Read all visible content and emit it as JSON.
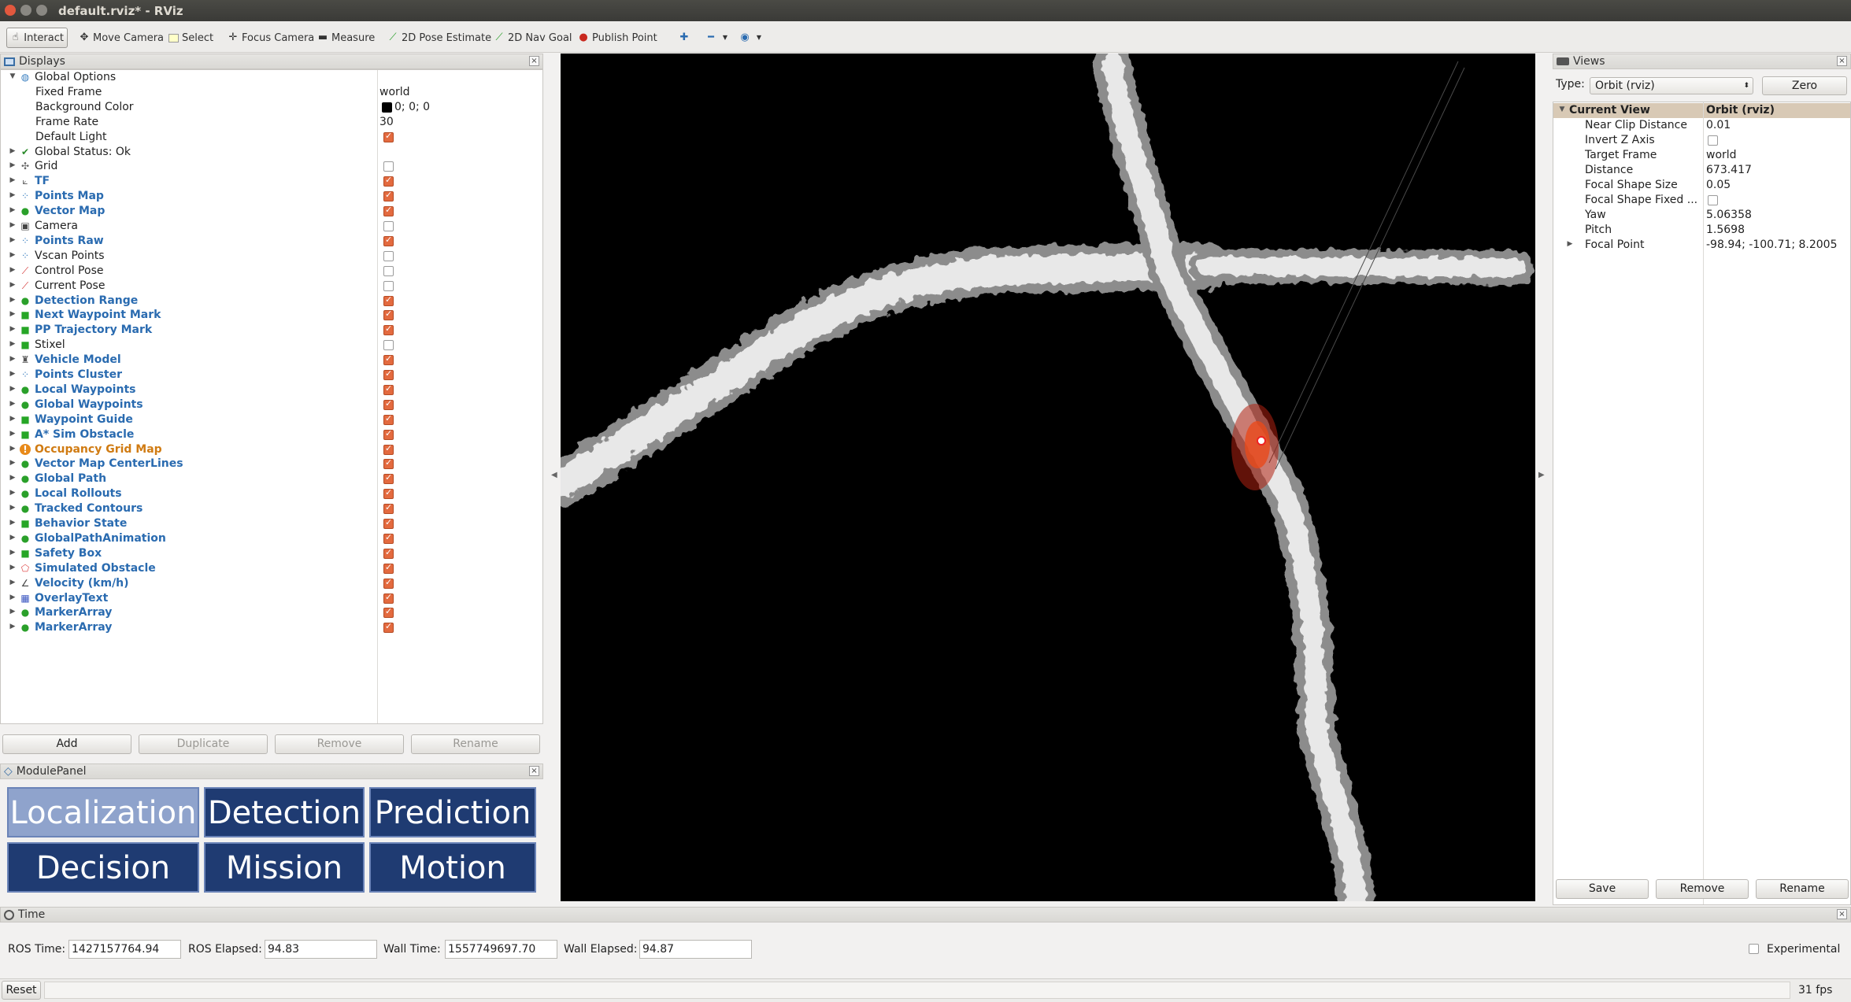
{
  "window": {
    "title": "default.rviz* - RViz"
  },
  "toolbar": {
    "tools": [
      {
        "label": "Interact",
        "icon": "hand-icon"
      },
      {
        "label": "Move Camera",
        "icon": "move-icon"
      },
      {
        "label": "Select",
        "icon": "select-icon"
      },
      {
        "label": "Focus Camera",
        "icon": "focus-icon"
      },
      {
        "label": "Measure",
        "icon": "ruler-icon"
      },
      {
        "label": "2D Pose Estimate",
        "icon": "pose-arrow-icon"
      },
      {
        "label": "2D Nav Goal",
        "icon": "nav-arrow-icon"
      },
      {
        "label": "Publish Point",
        "icon": "pin-icon"
      }
    ]
  },
  "displays": {
    "title": "Displays",
    "global_options": {
      "label": "Global Options",
      "props": [
        {
          "name": "Fixed Frame",
          "value": "world"
        },
        {
          "name": "Background Color",
          "value": "0; 0; 0"
        },
        {
          "name": "Frame Rate",
          "value": "30"
        },
        {
          "name": "Default Light",
          "value": ""
        }
      ]
    },
    "items": [
      {
        "label": "Global Status: Ok",
        "style": "normal",
        "icon": "check-icon",
        "checked": null
      },
      {
        "label": "Grid",
        "style": "normal",
        "icon": "grid-icon",
        "checked": false
      },
      {
        "label": "TF",
        "style": "blue",
        "icon": "tf-icon",
        "checked": true
      },
      {
        "label": "Points Map",
        "style": "blue",
        "icon": "points-icon",
        "checked": true
      },
      {
        "label": "Vector Map",
        "style": "blue",
        "icon": "marker-icon",
        "checked": true
      },
      {
        "label": "Camera",
        "style": "normal",
        "icon": "camera-icon",
        "checked": false
      },
      {
        "label": "Points Raw",
        "style": "blue",
        "icon": "points-icon",
        "checked": true
      },
      {
        "label": "Vscan Points",
        "style": "normal",
        "icon": "points-icon",
        "checked": false
      },
      {
        "label": "Control Pose",
        "style": "normal",
        "icon": "pose-icon",
        "checked": false
      },
      {
        "label": "Current Pose",
        "style": "normal",
        "icon": "pose-icon",
        "checked": false
      },
      {
        "label": "Detection Range",
        "style": "blue",
        "icon": "marker-icon",
        "checked": true
      },
      {
        "label": "Next Waypoint Mark",
        "style": "blue",
        "icon": "cube-icon",
        "checked": true
      },
      {
        "label": "PP Trajectory Mark",
        "style": "blue",
        "icon": "cube-icon",
        "checked": true
      },
      {
        "label": "Stixel",
        "style": "normal",
        "icon": "cube-icon",
        "checked": false
      },
      {
        "label": "Vehicle Model",
        "style": "blue",
        "icon": "robot-icon",
        "checked": true
      },
      {
        "label": "Points Cluster",
        "style": "blue",
        "icon": "points-icon",
        "checked": true
      },
      {
        "label": "Local Waypoints",
        "style": "blue",
        "icon": "marker-icon",
        "checked": true
      },
      {
        "label": "Global Waypoints",
        "style": "blue",
        "icon": "marker-icon",
        "checked": true
      },
      {
        "label": "Waypoint Guide",
        "style": "blue",
        "icon": "cube-icon",
        "checked": true
      },
      {
        "label": "A* Sim Obstacle",
        "style": "blue",
        "icon": "cube-icon",
        "checked": true
      },
      {
        "label": "Occupancy Grid Map",
        "style": "orange",
        "icon": "warning-icon",
        "checked": true
      },
      {
        "label": "Vector Map CenterLines",
        "style": "blue",
        "icon": "marker-icon",
        "checked": true
      },
      {
        "label": "Global Path",
        "style": "blue",
        "icon": "marker-icon",
        "checked": true
      },
      {
        "label": "Local Rollouts",
        "style": "blue",
        "icon": "marker-icon",
        "checked": true
      },
      {
        "label": "Tracked Contours",
        "style": "blue",
        "icon": "marker-icon",
        "checked": true
      },
      {
        "label": "Behavior State",
        "style": "blue",
        "icon": "cube-icon",
        "checked": true
      },
      {
        "label": "GlobalPathAnimation",
        "style": "blue",
        "icon": "marker-icon",
        "checked": true
      },
      {
        "label": "Safety Box",
        "style": "blue",
        "icon": "cube-icon",
        "checked": true
      },
      {
        "label": "Simulated Obstacle",
        "style": "blue",
        "icon": "polygon-icon",
        "checked": true
      },
      {
        "label": "Velocity (km/h)",
        "style": "blue",
        "icon": "plot-icon",
        "checked": true
      },
      {
        "label": "OverlayText",
        "style": "blue",
        "icon": "text-icon",
        "checked": true
      },
      {
        "label": "MarkerArray",
        "style": "blue",
        "icon": "marker-icon",
        "checked": true
      },
      {
        "label": "MarkerArray",
        "style": "blue",
        "icon": "marker-icon",
        "checked": true
      }
    ],
    "buttons": {
      "add": "Add",
      "duplicate": "Duplicate",
      "remove": "Remove",
      "rename": "Rename"
    }
  },
  "module_panel": {
    "title": "ModulePanel",
    "buttons": [
      "Localization",
      "Detection",
      "Prediction",
      "Decision",
      "Mission",
      "Motion"
    ],
    "selected": "Localization"
  },
  "views": {
    "title": "Views",
    "type_label": "Type:",
    "type_value": "Orbit (rviz)",
    "zero": "Zero",
    "current_view": {
      "label": "Current View",
      "value": "Orbit (rviz)"
    },
    "props": [
      {
        "name": "Near Clip Distance",
        "value": "0.01"
      },
      {
        "name": "Invert Z Axis",
        "value": ""
      },
      {
        "name": "Target Frame",
        "value": "world"
      },
      {
        "name": "Distance",
        "value": "673.417"
      },
      {
        "name": "Focal Shape Size",
        "value": "0.05"
      },
      {
        "name": "Focal Shape Fixed ...",
        "value": ""
      },
      {
        "name": "Yaw",
        "value": "5.06358"
      },
      {
        "name": "Pitch",
        "value": "1.5698"
      },
      {
        "name": "Focal Point",
        "value": "-98.94; -100.71; 8.2005"
      }
    ],
    "buttons": {
      "save": "Save",
      "remove": "Remove",
      "rename": "Rename"
    }
  },
  "time": {
    "title": "Time",
    "ros_time_label": "ROS Time:",
    "ros_time": "1427157764.94",
    "ros_elapsed_label": "ROS Elapsed:",
    "ros_elapsed": "94.83",
    "wall_time_label": "Wall Time:",
    "wall_time": "1557749697.70",
    "wall_elapsed_label": "Wall Elapsed:",
    "wall_elapsed": "94.87",
    "experimental": "Experimental"
  },
  "statusbar": {
    "reset": "Reset",
    "fps": "31 fps"
  },
  "colors": {
    "accent_check": "#e36a3f",
    "display_blue": "#2a6bb0",
    "module_blue": "#1f3b72",
    "module_selected": "#8fa3cc"
  }
}
